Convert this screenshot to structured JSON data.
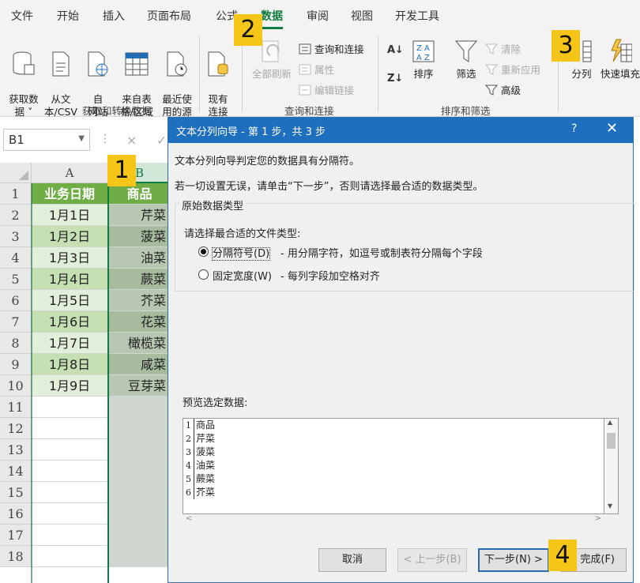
{
  "tabs": [
    "文件",
    "开始",
    "插入",
    "页面布局",
    "公式",
    "数据",
    "审阅",
    "视图",
    "开发工具"
  ],
  "ribbon": {
    "get_data": "获取数\n据 ˅",
    "from_text": "从文\n本/CSV",
    "from_web": "自\n网站",
    "from_table": "来自表\n格/区域",
    "recent": "最近使\n用的源",
    "existing": "现有\n连接",
    "group1": "获取和转换数据",
    "refresh_all": "全部刷新",
    "queries": "查询和连接",
    "properties": "属性",
    "edit_links": "编辑链接",
    "group2": "查询和连接",
    "sort": "排序",
    "filter": "筛选",
    "clear": "清除",
    "reapply": "重新应用",
    "advanced": "高级",
    "group3": "排序和筛选",
    "split": "分列",
    "flash_fill": "快速填充"
  },
  "formula": {
    "namebox": "B1",
    "cancel": "×",
    "confirm": "✓"
  },
  "columns": [
    "A",
    "B"
  ],
  "rows": [
    "1",
    "2",
    "3",
    "4",
    "5",
    "6",
    "7",
    "8",
    "9",
    "10",
    "11",
    "12",
    "13",
    "14",
    "15",
    "16",
    "17",
    "18"
  ],
  "colA": [
    "业务日期",
    "1月1日",
    "1月2日",
    "1月3日",
    "1月4日",
    "1月5日",
    "1月6日",
    "1月7日",
    "1月8日",
    "1月9日"
  ],
  "colB": [
    "商品",
    "芹菜",
    "菠菜",
    "油菜",
    "蕨菜",
    "芥菜",
    "花菜",
    "橄榄菜",
    "咸菜",
    "豆芽菜"
  ],
  "badges": [
    "1",
    "2",
    "3",
    "4"
  ],
  "dialog": {
    "title": "文本分列向导 - 第 1 步，共 3 步",
    "help": "?",
    "close": "✕",
    "line1": "文本分列向导判定您的数据具有分隔符。",
    "line2": "若一切设置无误，请单击“下一步”，否则请选择最合适的数据类型。",
    "group_label": "原始数据类型",
    "choose": "请选择最合适的文件类型:",
    "opt1_label": "分隔符号(D)",
    "opt1_desc": "- 用分隔字符，如逗号或制表符分隔每个字段",
    "opt2_label": "固定宽度(W)",
    "opt2_desc": "- 每列字段加空格对齐",
    "preview_label": "预览选定数据:",
    "preview_rows": [
      {
        "n": "1",
        "v": "商品"
      },
      {
        "n": "2",
        "v": "芹菜"
      },
      {
        "n": "3",
        "v": "菠菜"
      },
      {
        "n": "4",
        "v": "油菜"
      },
      {
        "n": "5",
        "v": "蕨菜"
      },
      {
        "n": "6",
        "v": "芥菜"
      }
    ],
    "cancel": "取消",
    "back": "< 上一步(B)",
    "next": "下一步(N) >",
    "finish": "完成(F)"
  },
  "colors": {
    "excel_green": "#107c41",
    "title_blue": "#1f6fbf",
    "badge": "#f5c518"
  }
}
